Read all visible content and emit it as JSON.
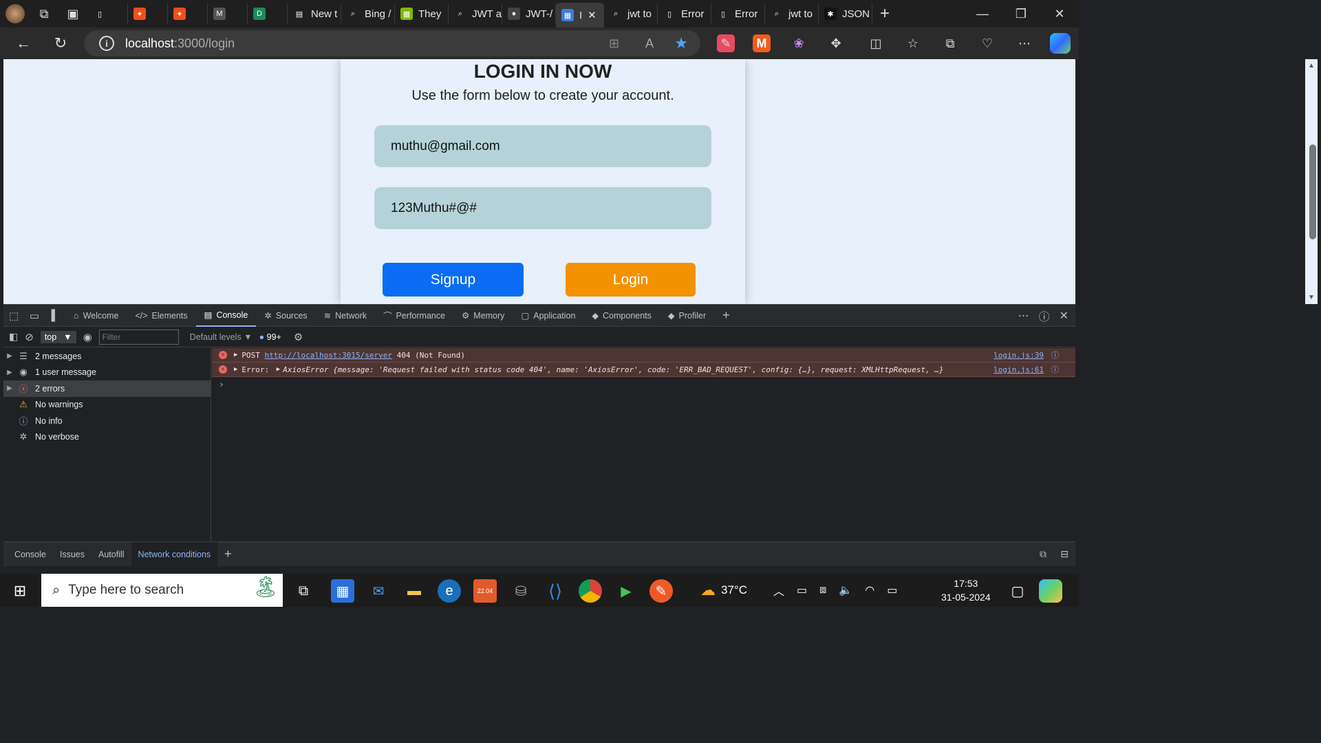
{
  "browser": {
    "tabs": [
      {
        "label": "",
        "icon": "blank-page-icon"
      },
      {
        "label": "",
        "icon": "figma-icon"
      },
      {
        "label": "",
        "icon": "figma-icon"
      },
      {
        "label": "",
        "icon": "m-logo-icon"
      },
      {
        "label": "",
        "icon": "d-logo-icon"
      },
      {
        "label": "New t",
        "icon": "newtab-icon"
      },
      {
        "label": "Bing /",
        "icon": "search-icon"
      },
      {
        "label": "They",
        "icon": "microsoft-icon"
      },
      {
        "label": "JWT a",
        "icon": "search-icon"
      },
      {
        "label": "JWT-/",
        "icon": "github-icon"
      },
      {
        "label": "I",
        "icon": "site-icon",
        "active": true
      },
      {
        "label": "jwt to",
        "icon": "search-icon"
      },
      {
        "label": "Error",
        "icon": "page-icon"
      },
      {
        "label": "Error",
        "icon": "page-icon"
      },
      {
        "label": "jwt to",
        "icon": "search-icon"
      },
      {
        "label": "JSON",
        "icon": "json-icon"
      }
    ],
    "url_host": "localhost",
    "url_rest": ":3000/login"
  },
  "page": {
    "title": "LOGIN IN NOW",
    "subtitle": "Use the form below to create your account.",
    "email": "muthu@gmail.com",
    "password": "123Muthu#@#",
    "signup_label": "Signup",
    "login_label": "Login",
    "signup_color": "#0a6cf5",
    "login_color": "#f39200"
  },
  "devtools": {
    "tabs": [
      "Welcome",
      "Elements",
      "Console",
      "Sources",
      "Network",
      "Performance",
      "Memory",
      "Application",
      "Components",
      "Profiler"
    ],
    "context": "top",
    "filter_placeholder": "Filter",
    "levels": "Default levels",
    "issues_count": "99+",
    "sidebar": [
      {
        "label": "2 messages",
        "icon": "list-icon"
      },
      {
        "label": "1 user message",
        "icon": "user-icon"
      },
      {
        "label": "2 errors",
        "icon": "error-icon",
        "selected": true
      },
      {
        "label": "No warnings",
        "icon": "warning-icon"
      },
      {
        "label": "No info",
        "icon": "info-icon"
      },
      {
        "label": "No verbose",
        "icon": "bug-icon"
      }
    ],
    "log": {
      "row1_method": "POST",
      "row1_url": "http://localhost:3015/server",
      "row1_status": "404 (Not Found)",
      "row1_src": "login.js:39",
      "row2_prefix": "Error:",
      "row2_text": "AxiosError {message: 'Request failed with status code 404', name: 'AxiosError', code: 'ERR_BAD_REQUEST', config: {…}, request: XMLHttpRequest, …}",
      "row2_src": "login.js:61"
    },
    "drawer_tabs": [
      "Console",
      "Issues",
      "Autofill",
      "Network conditions"
    ]
  },
  "taskbar": {
    "search_placeholder": "Type here to search",
    "temperature": "37°C",
    "time": "17:53",
    "date": "31-05-2024"
  }
}
